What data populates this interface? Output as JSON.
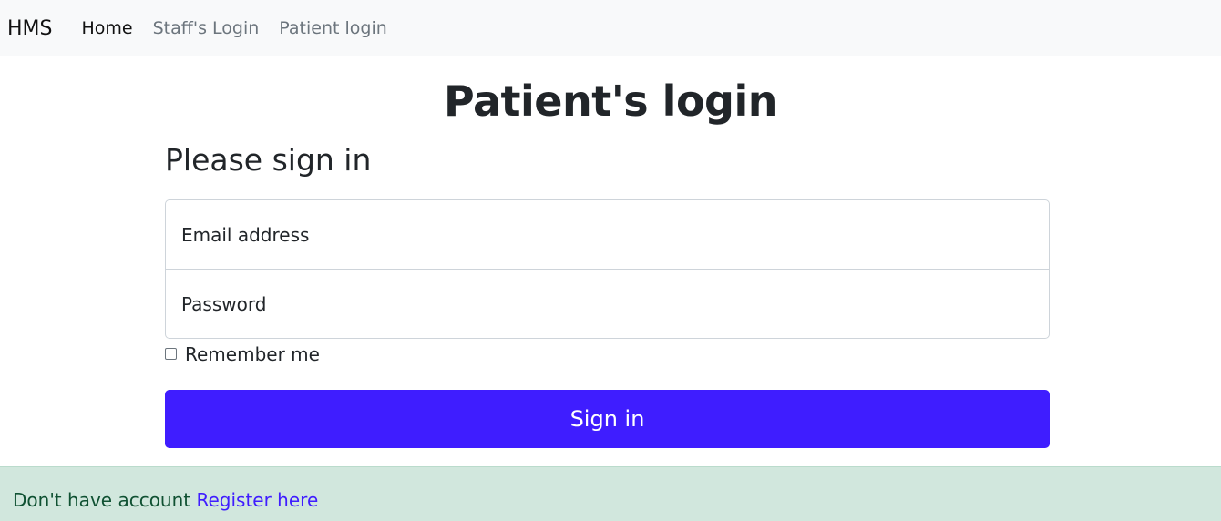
{
  "nav": {
    "brand": "HMS",
    "items": [
      {
        "label": "Home",
        "active": true
      },
      {
        "label": "Staff's Login",
        "active": false
      },
      {
        "label": "Patient login",
        "active": false
      }
    ]
  },
  "page": {
    "title": "Patient's login",
    "subtitle": "Please sign in"
  },
  "form": {
    "email_placeholder": "Email address",
    "password_placeholder": "Password",
    "remember_label": "Remember me",
    "remember_checked": false,
    "submit_label": "Sign in"
  },
  "footer": {
    "text": "Don't have account",
    "link_label": "Register here"
  },
  "colors": {
    "primary": "#3f1dff",
    "navbar_bg": "#f8f9fa",
    "alert_bg": "#d1e7dd",
    "alert_text": "#0f5132"
  }
}
